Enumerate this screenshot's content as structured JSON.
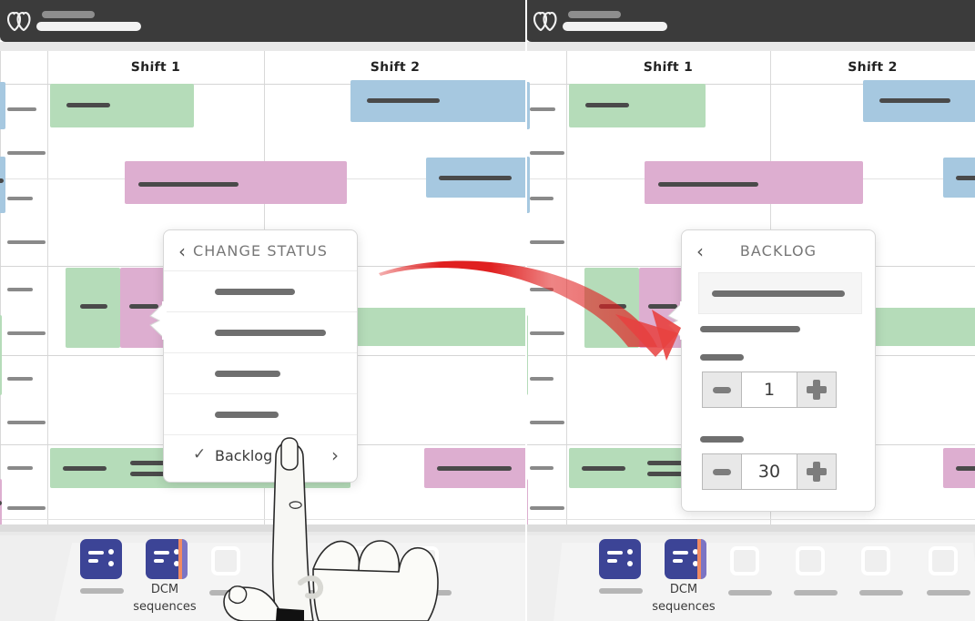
{
  "app": {
    "logo_icon": "overlapping-rings-logo",
    "title_redacted": true
  },
  "panels": [
    {
      "id": "before",
      "calendar": {
        "columns": [
          {
            "label": "Shift 1"
          },
          {
            "label": "Shift 2"
          }
        ]
      },
      "popup": {
        "title": "CHANGE STATUS",
        "back_icon": "chevron-left-icon",
        "items": [
          {
            "label": "",
            "redacted": true,
            "redact_width": 88
          },
          {
            "label": "",
            "redacted": true,
            "redact_width": 122
          },
          {
            "label": "",
            "redacted": true,
            "redact_width": 72
          },
          {
            "label": "",
            "redacted": true,
            "redact_width": 70
          }
        ],
        "selected": {
          "label": "Backlog",
          "check_icon": "check-icon",
          "forward_icon": "chevron-right-icon"
        }
      }
    },
    {
      "id": "after",
      "calendar": {
        "columns": [
          {
            "label": "Shift 1"
          },
          {
            "label": "Shift 2"
          }
        ]
      },
      "popup": {
        "title": "BACKLOG",
        "back_icon": "chevron-left-icon",
        "search_field": {
          "value": "",
          "redacted": true
        },
        "label_1": {
          "text": "",
          "redacted": true
        },
        "label_2": {
          "text": "",
          "redacted": true
        },
        "stepper_1": {
          "value": "1",
          "decrement_icon": "minus-icon",
          "increment_icon": "plus-icon"
        },
        "label_3": {
          "text": "",
          "redacted": true
        },
        "stepper_2": {
          "value": "30",
          "decrement_icon": "minus-icon",
          "increment_icon": "plus-icon"
        }
      }
    }
  ],
  "dock": {
    "apps": [
      {
        "name": "app-1",
        "label": "",
        "redacted": true,
        "icon": "list-card-icon"
      },
      {
        "name": "dcm-sequences",
        "label_line1": "DCM",
        "label_line2": "sequences",
        "icon": "list-card-striped-icon"
      },
      {
        "name": "app-3",
        "label": "",
        "redacted": true,
        "icon": "empty-slot-icon"
      },
      {
        "name": "app-4",
        "label": "",
        "redacted": true,
        "icon": "empty-slot-icon"
      },
      {
        "name": "app-5",
        "label": "",
        "redacted": true,
        "icon": "empty-slot-icon"
      },
      {
        "name": "app-6",
        "label": "",
        "redacted": true,
        "icon": "empty-slot-icon"
      }
    ]
  },
  "annotation": {
    "arrow_icon": "curved-red-arrow",
    "arrow_color": "#e02020",
    "hand_icon": "pointing-hand-illustration"
  },
  "colors": {
    "event_green": "#b5dcb9",
    "event_blue": "#a6c8e0",
    "event_pink": "#ddaed0",
    "titlebar": "#3b3b3b",
    "dock_icon": "#3c4496",
    "accent_red": "#e02020"
  },
  "events": {
    "green_label": "",
    "blue_label": "",
    "pink_label": ""
  }
}
